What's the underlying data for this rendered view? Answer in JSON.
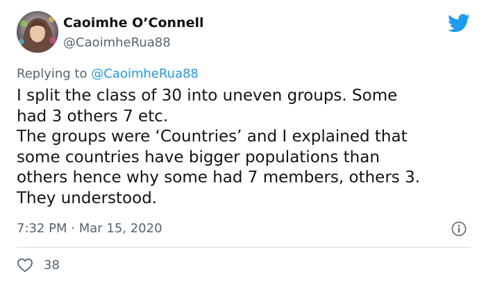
{
  "author": {
    "display_name": "Caoimhe O’Connell",
    "handle": "@CaoimheRua88"
  },
  "reply": {
    "prefix": "Replying to",
    "mention": "@CaoimheRua88"
  },
  "tweet_lines": [
    "I split the class of 30 into uneven groups. Some",
    "had 3 others 7 etc.",
    "The groups were ‘Countries’ and I explained that",
    "some countries have bigger populations than",
    "others hence why some had 7 members, others 3.",
    "They understood."
  ],
  "timestamp": "7:32 PM · Mar 15, 2020",
  "likes": "38",
  "icons": {
    "brand": "twitter-bird-icon",
    "info": "info-icon",
    "like": "heart-icon"
  },
  "colors": {
    "twitter_blue": "#1d9bf0",
    "text_primary": "#0f1419",
    "text_secondary": "#536471",
    "divider": "#cfd9de"
  }
}
